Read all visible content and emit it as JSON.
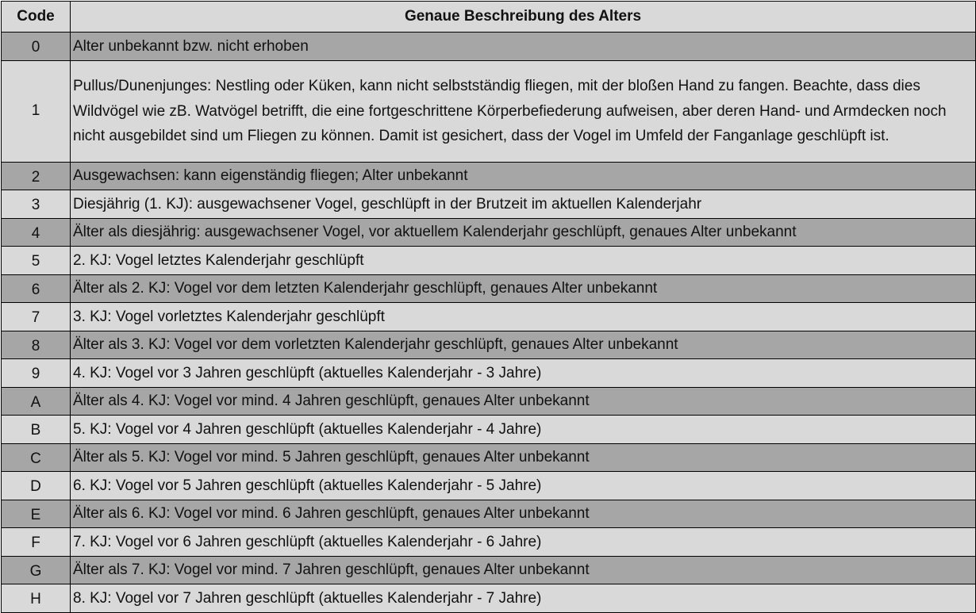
{
  "table": {
    "headers": {
      "code": "Code",
      "description": "Genaue Beschreibung des Alters"
    },
    "rows": [
      {
        "code": "0",
        "description": "Alter unbekannt bzw. nicht erhoben",
        "shade": "dark"
      },
      {
        "code": "1",
        "description": "Pullus/Dunenjunges: Nestling oder Küken, kann nicht selbstständig fliegen, mit der bloßen Hand zu fangen. Beachte, dass dies Wildvögel wie zB. Watvögel betrifft, die eine fortgeschrittene Körperbefiederung aufweisen, aber deren Hand- und Armdecken noch nicht ausgebildet sind um Fliegen zu können. Damit ist gesichert, dass der Vogel im Umfeld der Fanganlage geschlüpft ist.",
        "shade": "light"
      },
      {
        "code": "2",
        "description": "Ausgewachsen: kann eigenständig fliegen; Alter unbekannt",
        "shade": "dark"
      },
      {
        "code": "3",
        "description": "Diesjährig (1. KJ): ausgewachsener Vogel, geschlüpft in der Brutzeit im aktuellen Kalenderjahr",
        "shade": "light"
      },
      {
        "code": "4",
        "description": "Älter als diesjährig: ausgewachsener Vogel, vor aktuellem Kalenderjahr geschlüpft, genaues Alter unbekannt",
        "shade": "dark"
      },
      {
        "code": "5",
        "description": "2. KJ: Vogel letztes Kalenderjahr geschlüpft",
        "shade": "light"
      },
      {
        "code": "6",
        "description": "Älter als 2. KJ: Vogel vor dem letzten Kalenderjahr geschlüpft, genaues Alter unbekannt",
        "shade": "dark"
      },
      {
        "code": "7",
        "description": "3. KJ: Vogel vorletztes Kalenderjahr geschlüpft",
        "shade": "light"
      },
      {
        "code": "8",
        "description": "Älter als 3. KJ: Vogel vor dem vorletzten Kalenderjahr geschlüpft, genaues Alter unbekannt",
        "shade": "dark"
      },
      {
        "code": "9",
        "description": "4. KJ: Vogel vor 3 Jahren geschlüpft (aktuelles Kalenderjahr - 3 Jahre)",
        "shade": "light"
      },
      {
        "code": "A",
        "description": "Älter als 4. KJ: Vogel vor mind. 4 Jahren geschlüpft, genaues Alter unbekannt",
        "shade": "dark"
      },
      {
        "code": "B",
        "description": "5. KJ: Vogel vor 4 Jahren geschlüpft (aktuelles Kalenderjahr - 4 Jahre)",
        "shade": "light"
      },
      {
        "code": "C",
        "description": "Älter als 5. KJ: Vogel vor mind. 5 Jahren geschlüpft, genaues Alter unbekannt",
        "shade": "dark"
      },
      {
        "code": "D",
        "description": "6. KJ: Vogel vor 5 Jahren geschlüpft (aktuelles Kalenderjahr - 5 Jahre)",
        "shade": "light"
      },
      {
        "code": "E",
        "description": "Älter als 6. KJ: Vogel vor mind.  6 Jahren geschlüpft, genaues Alter unbekannt",
        "shade": "dark"
      },
      {
        "code": "F",
        "description": "7. KJ: Vogel vor 6 Jahren geschlüpft (aktuelles Kalenderjahr - 6 Jahre)",
        "shade": "light"
      },
      {
        "code": "G",
        "description": "Älter als 7. KJ: Vogel vor mind.  7 Jahren geschlüpft, genaues Alter unbekannt",
        "shade": "dark"
      },
      {
        "code": "H",
        "description": "8. KJ: Vogel vor 7 Jahren geschlüpft (aktuelles Kalenderjahr - 7 Jahre)",
        "shade": "light"
      }
    ]
  },
  "colors": {
    "header_bg": "#d9d9d9",
    "dark_row_bg": "#a6a6a6",
    "light_row_bg": "#d9d9d9",
    "border": "#000000"
  }
}
